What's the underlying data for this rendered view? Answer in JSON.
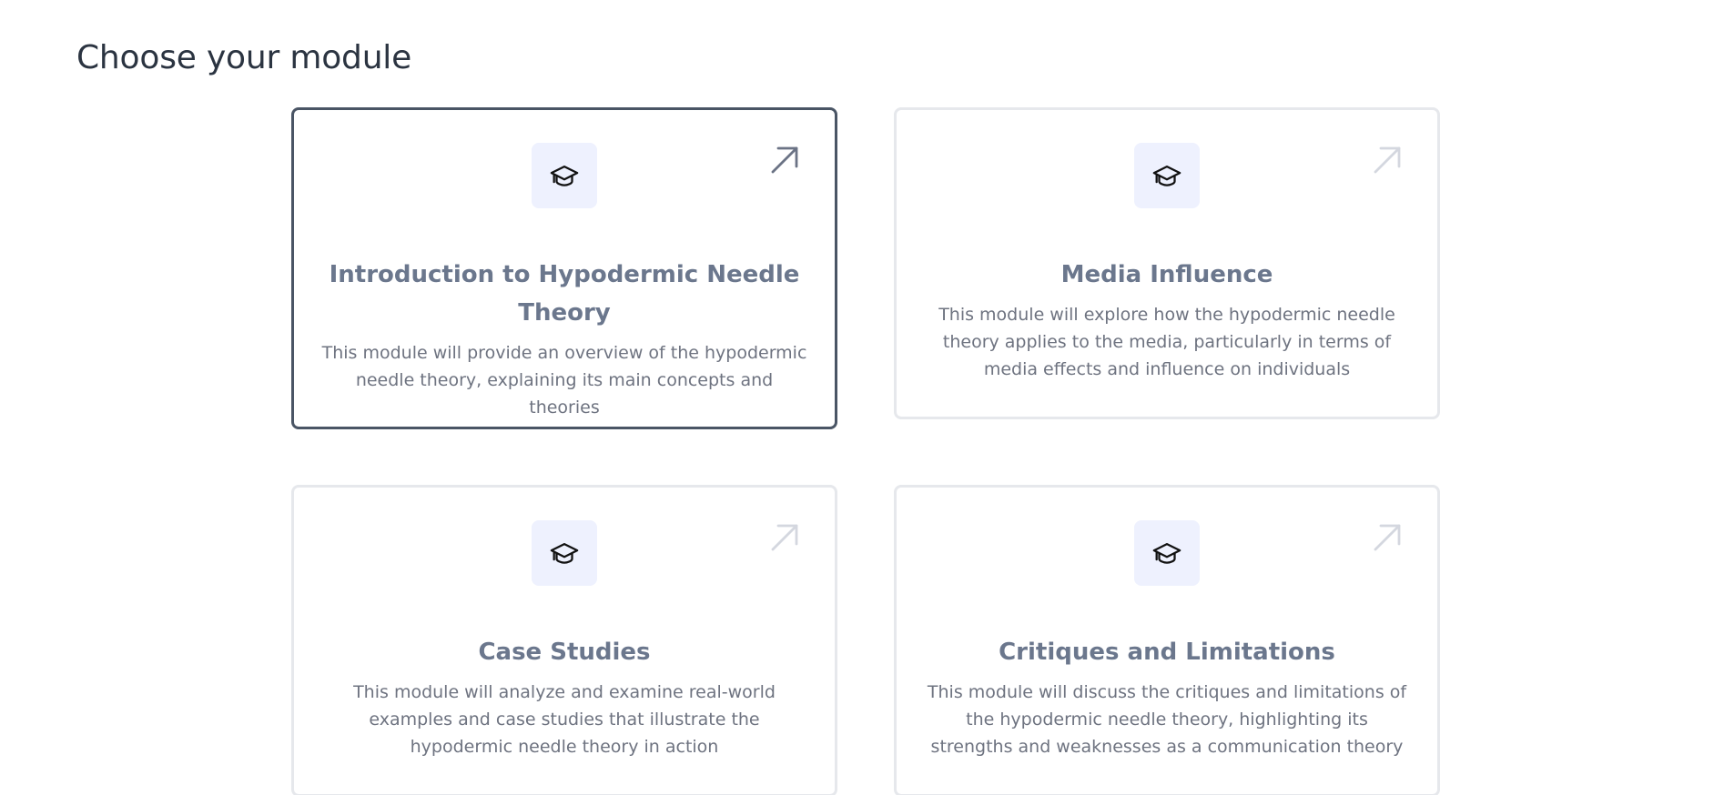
{
  "header": {
    "title": "Choose your module"
  },
  "colors": {
    "selected_border": "#4a5565",
    "card_border": "#e6e8ec",
    "icon_bg": "#eef1fe",
    "title_text": "#6b778d",
    "desc_text": "#6e7380"
  },
  "modules": [
    {
      "title": "Introduction to Hypodermic Needle Theory",
      "description": "This module will provide an overview of the hypodermic needle theory, explaining its main concepts and theories",
      "icon": "graduation-cap-icon",
      "selected": true
    },
    {
      "title": "Media Influence",
      "description": "This module will explore how the hypodermic needle theory applies to the media, particularly in terms of media effects and influence on individuals",
      "icon": "graduation-cap-icon",
      "selected": false
    },
    {
      "title": "Case Studies",
      "description": "This module will analyze and examine real-world examples and case studies that illustrate the hypodermic needle theory in action",
      "icon": "graduation-cap-icon",
      "selected": false
    },
    {
      "title": "Critiques and Limitations",
      "description": "This module will discuss the critiques and limitations of the hypodermic needle theory, highlighting its strengths and weaknesses as a communication theory",
      "icon": "graduation-cap-icon",
      "selected": false
    }
  ]
}
